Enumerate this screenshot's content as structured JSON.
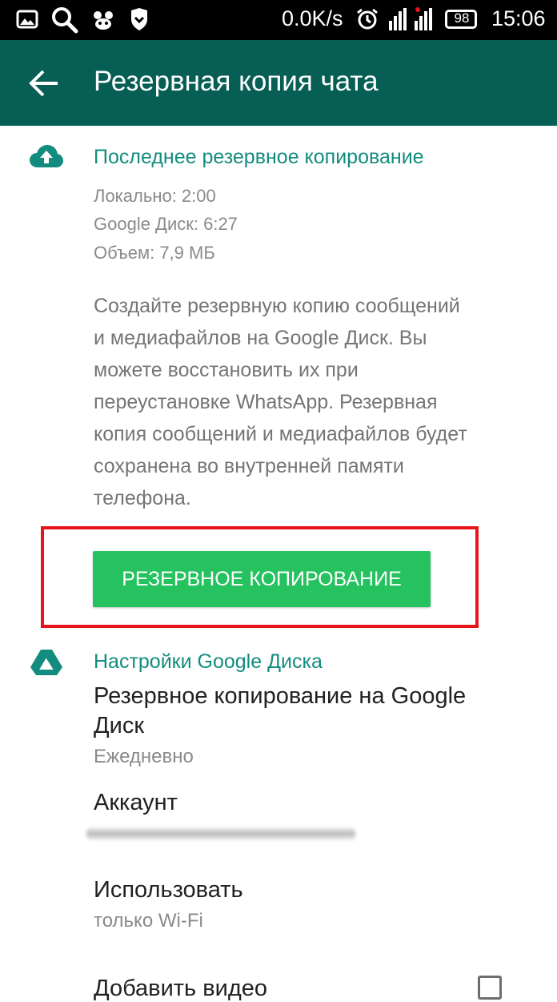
{
  "status_bar": {
    "network_speed": "0.0K/s",
    "battery_level": "98",
    "time": "15:06",
    "icons": [
      "gallery-icon",
      "search-icon",
      "app-icon",
      "shield-icon",
      "alarm-icon",
      "signal-icon",
      "battery-icon"
    ]
  },
  "app_bar": {
    "title": "Резервная копия чата",
    "background": "#075e54"
  },
  "last_backup": {
    "title": "Последнее резервное копирование",
    "local": "Локально: 2:00",
    "google_drive": "Google Диск: 6:27",
    "size": "Объем: 7,9 МБ",
    "description_lines": [
      "Создайте резервную копию сообщений",
      "и медиафайлов на Google Диск. Вы",
      "можете восстановить их при",
      "переустановке WhatsApp. Резервная",
      "копия сообщений и медиафайлов будет",
      "сохранена во внутренней памяти",
      "телефона."
    ],
    "backup_button": "РЕЗЕРВНОЕ КОПИРОВАНИЕ"
  },
  "drive_settings": {
    "title": "Настройки Google Диска",
    "backup_to_drive": {
      "title_line1": "Резервное копирование на Google",
      "title_line2": "Диск",
      "value": "Ежедневно"
    },
    "account": {
      "title": "Аккаунт"
    },
    "use_network": {
      "title": "Использовать",
      "value": "только Wi-Fi"
    },
    "include_videos": {
      "title": "Добавить видео",
      "checked": false
    }
  },
  "colors": {
    "accent": "#128c7e",
    "button": "#25c25f",
    "highlight": "#e8141c"
  }
}
